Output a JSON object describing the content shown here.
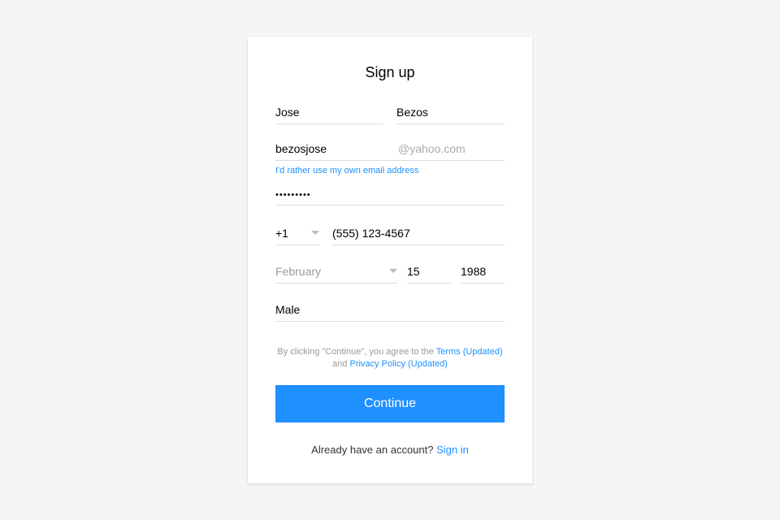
{
  "title": "Sign up",
  "firstName": "Jose",
  "lastName": "Bezos",
  "emailLocal": "bezosjose",
  "emailDomain": "@yahoo.com",
  "useOwnEmail": "I'd rather use my own email address",
  "password": "•••••••••",
  "countryCode": "+1",
  "phone": "(555) 123-4567",
  "birthMonth": "February",
  "birthDay": "15",
  "birthYear": "1988",
  "gender": "Male",
  "agree": {
    "prefix": "By clicking \"Continue\", you agree to the ",
    "terms": "Terms (Updated)",
    "mid": " and ",
    "privacy": "Privacy Policy (Updated)"
  },
  "continue": "Continue",
  "haveAccount": "Already have an account? ",
  "signIn": "Sign in"
}
